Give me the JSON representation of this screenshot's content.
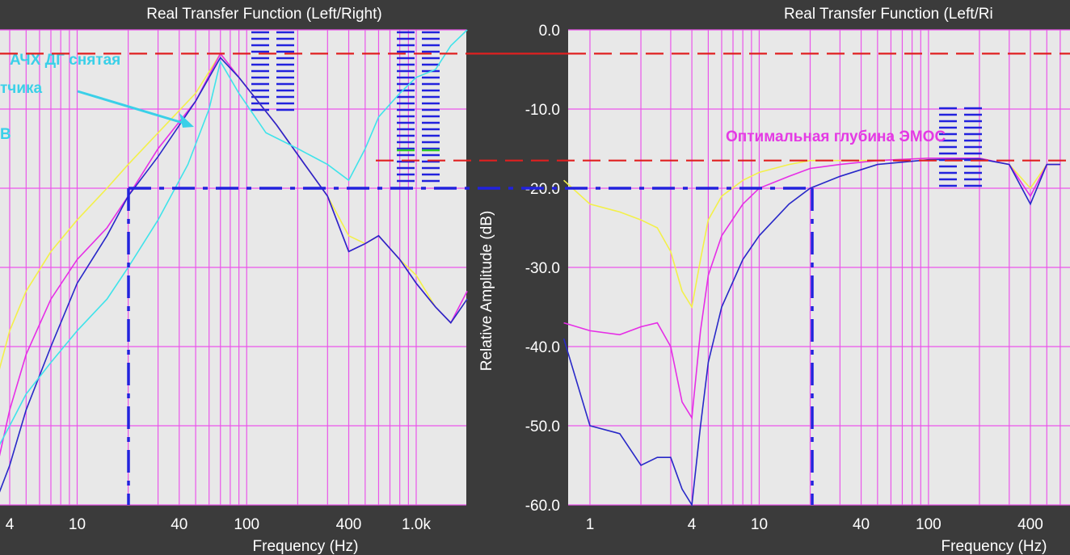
{
  "colors": {
    "background": "#3b3b3b",
    "plot_bg": "#e8e8e8",
    "grid": "#ea55ea",
    "yellow": "#f3f04a",
    "magenta": "#e62ee6",
    "blue": "#2828c8",
    "cyan": "#3fe3ea",
    "red_dash": "#e02020",
    "blue_dash": "#2222dd",
    "annotation_magenta": "#e43ae4",
    "annotation_cyan": "#3ad0e8"
  },
  "chart_data": [
    {
      "type": "line",
      "title": "Real Transfer Function (Left/Right)",
      "xlabel": "Frequency (Hz)",
      "x_scale": "log",
      "x_ticks": [
        "4",
        "10",
        "40",
        "100",
        "400",
        "1.0k"
      ],
      "annotations": [
        "АЧХ ДГ снятая",
        "тчика",
        "В"
      ],
      "series": [
        {
          "color": "yellow",
          "x": [
            2,
            2.5,
            3,
            4,
            5,
            7,
            10,
            15,
            20,
            30,
            50,
            70,
            90,
            150,
            220,
            300,
            400,
            500,
            600,
            800,
            1000,
            1300,
            1600,
            2000
          ],
          "y": [
            -40,
            -46,
            -48,
            -38,
            -33,
            -28,
            -24,
            -20,
            -17,
            -13,
            -8,
            -3,
            -6,
            -12,
            -17,
            -21,
            -26,
            -27,
            -26,
            -29,
            -31,
            -35,
            -37,
            -34
          ]
        },
        {
          "color": "magenta",
          "x": [
            2,
            2.5,
            3,
            4,
            5,
            7,
            10,
            15,
            20,
            30,
            50,
            70,
            90,
            150,
            220,
            300,
            400,
            500,
            600,
            800,
            1000,
            1300,
            1600,
            2000
          ],
          "y": [
            -60,
            -62,
            -60,
            -48,
            -41,
            -34,
            -29,
            -25,
            -21,
            -15,
            -9,
            -3,
            -6,
            -12,
            -17,
            -21,
            -28,
            -27,
            -26,
            -29,
            -32,
            -35,
            -37,
            -33
          ]
        },
        {
          "color": "blue",
          "x": [
            2,
            2.5,
            3,
            4,
            5,
            7,
            10,
            15,
            20,
            30,
            50,
            70,
            90,
            150,
            220,
            300,
            400,
            500,
            600,
            800,
            1000,
            1300,
            1600,
            2000
          ],
          "y": [
            -62,
            -63,
            -62,
            -55,
            -48,
            -40,
            -32,
            -26,
            -21,
            -16,
            -9,
            -3.5,
            -6,
            -12,
            -17,
            -21,
            -28,
            -27,
            -26,
            -29,
            -32,
            -35,
            -37,
            -34
          ]
        },
        {
          "color": "cyan",
          "x": [
            2,
            2.5,
            3,
            4,
            5,
            7,
            10,
            15,
            20,
            30,
            45,
            60,
            70,
            90,
            130,
            200,
            300,
            400,
            500,
            600,
            800,
            1000,
            1300,
            1600,
            2000
          ],
          "y": [
            -55,
            -58,
            -55,
            -50,
            -46,
            -42,
            -38,
            -34,
            -30,
            -24,
            -17,
            -10,
            -4,
            -8,
            -13,
            -15,
            -17,
            -19,
            -15,
            -11,
            -8,
            -6,
            -5,
            -2,
            0
          ]
        }
      ]
    },
    {
      "type": "line",
      "title": "Real Transfer Function (Left/Ri",
      "xlabel": "Frequency (Hz)",
      "ylabel": "Relative Amplitude (dB)",
      "x_scale": "log",
      "ylim": [
        -60,
        0
      ],
      "y_ticks": [
        "0.0",
        "-10.0",
        "-20.0",
        "-30.0",
        "-40.0",
        "-50.0",
        "-60.0"
      ],
      "x_ticks": [
        "1",
        "4",
        "10",
        "40",
        "100",
        "400"
      ],
      "annotations": [
        "Оптимальная глубина ЭМОС"
      ],
      "series": [
        {
          "color": "yellow",
          "x": [
            0.7,
            1,
            1.5,
            2,
            2.5,
            3,
            3.5,
            4,
            4.5,
            5,
            6,
            8,
            10,
            15,
            20,
            30,
            50,
            100,
            200,
            300,
            400,
            500,
            600
          ],
          "y": [
            -19,
            -22,
            -23,
            -24,
            -25,
            -28,
            -33,
            -35,
            -29,
            -24,
            -21,
            -19,
            -18,
            -17,
            -16.5,
            -16.5,
            -16.5,
            -16.2,
            -16.2,
            -17,
            -20,
            -17,
            -17
          ]
        },
        {
          "color": "magenta",
          "x": [
            0.7,
            1,
            1.5,
            2,
            2.5,
            3,
            3.5,
            4,
            4.5,
            5,
            6,
            8,
            10,
            15,
            20,
            30,
            50,
            100,
            200,
            300,
            400,
            500,
            600
          ],
          "y": [
            -37,
            -38,
            -38.5,
            -37.5,
            -37,
            -40,
            -47,
            -49,
            -38,
            -31,
            -26,
            -22,
            -20,
            -18.5,
            -17.5,
            -17,
            -16.5,
            -16.2,
            -16.2,
            -17,
            -21,
            -17,
            -17
          ]
        },
        {
          "color": "blue",
          "x": [
            0.7,
            1,
            1.5,
            2,
            2.5,
            3,
            3.5,
            4,
            4.5,
            5,
            6,
            8,
            10,
            15,
            20,
            30,
            50,
            100,
            200,
            300,
            400,
            500,
            600
          ],
          "y": [
            -39,
            -50,
            -51,
            -55,
            -54,
            -54,
            -58,
            -60,
            -50,
            -42,
            -35,
            -29,
            -26,
            -22,
            -20,
            -18.5,
            -17,
            -16.4,
            -16.3,
            -17,
            -22,
            -17,
            -17
          ]
        }
      ]
    }
  ]
}
